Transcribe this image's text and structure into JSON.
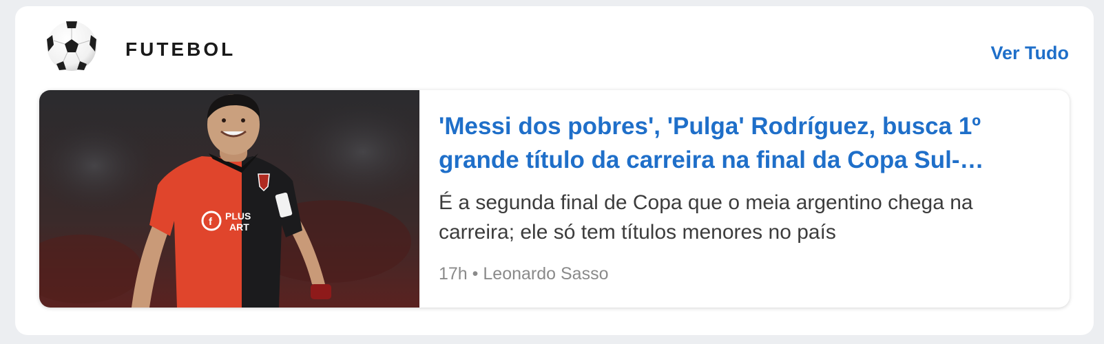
{
  "section": {
    "title": "FUTEBOL",
    "icon": "soccer-ball-icon",
    "see_all_label": "Ver Tudo"
  },
  "article": {
    "headline": "'Messi dos pobres', 'Pulga' Rodríguez, busca 1º grande título da carreira na final da Copa Sul-Americana",
    "summary": "É a segunda final de Copa que o meia argentino chega na carreira; ele só tem títulos menores no país",
    "time": "17h",
    "separator": "•",
    "author": "Leonardo Sasso",
    "image_jersey_text": "PLUS ART"
  },
  "colors": {
    "accent": "#1f6fc9",
    "background": "#eceef1",
    "card": "#ffffff",
    "jersey_red": "#e0452c",
    "jersey_black": "#1b1b1d"
  }
}
